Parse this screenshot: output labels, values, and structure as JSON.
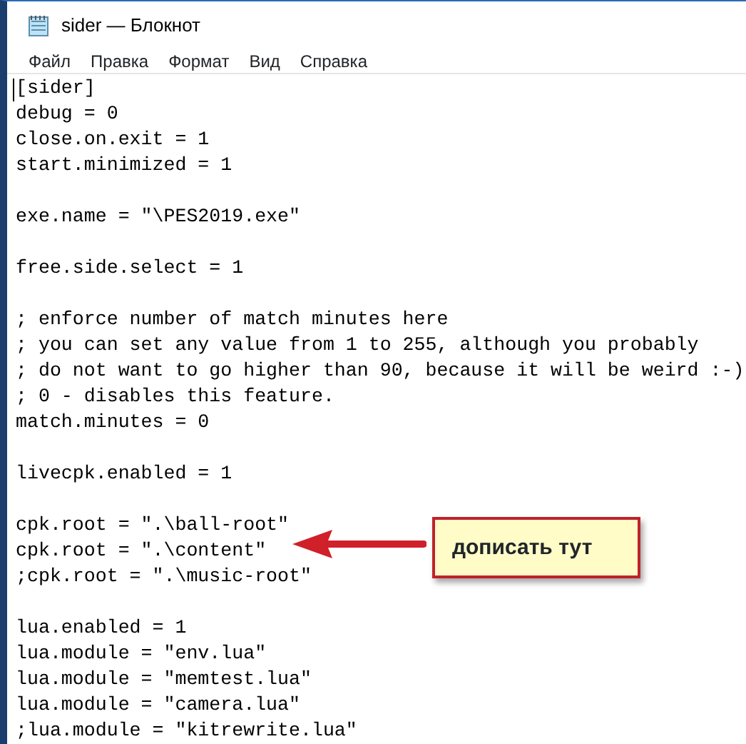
{
  "window": {
    "title": "sider — Блокнот"
  },
  "menu": [
    "Файл",
    "Правка",
    "Формат",
    "Вид",
    "Справка"
  ],
  "editor": {
    "blocks": [
      [
        "[sider]",
        "debug = 0",
        "close.on.exit = 1",
        "start.minimized = 1"
      ],
      [
        "exe.name = \"\\PES2019.exe\""
      ],
      [
        "free.side.select = 1"
      ],
      [
        "; enforce number of match minutes here",
        "; you can set any value from 1 to 255, although you probably",
        "; do not want to go higher than 90, because it will be weird :-)",
        "; 0 - disables this feature.",
        "match.minutes = 0"
      ],
      [
        "livecpk.enabled = 1"
      ],
      [
        "cpk.root = \".\\ball-root\"",
        "cpk.root = \".\\content\"",
        ";cpk.root = \".\\music-root\""
      ],
      [
        "lua.enabled = 1",
        "lua.module = \"env.lua\"",
        "lua.module = \"memtest.lua\"",
        "lua.module = \"camera.lua\"",
        ";lua.module = \"kitrewrite.lua\""
      ]
    ]
  },
  "callout": {
    "text": "дописать тут"
  }
}
